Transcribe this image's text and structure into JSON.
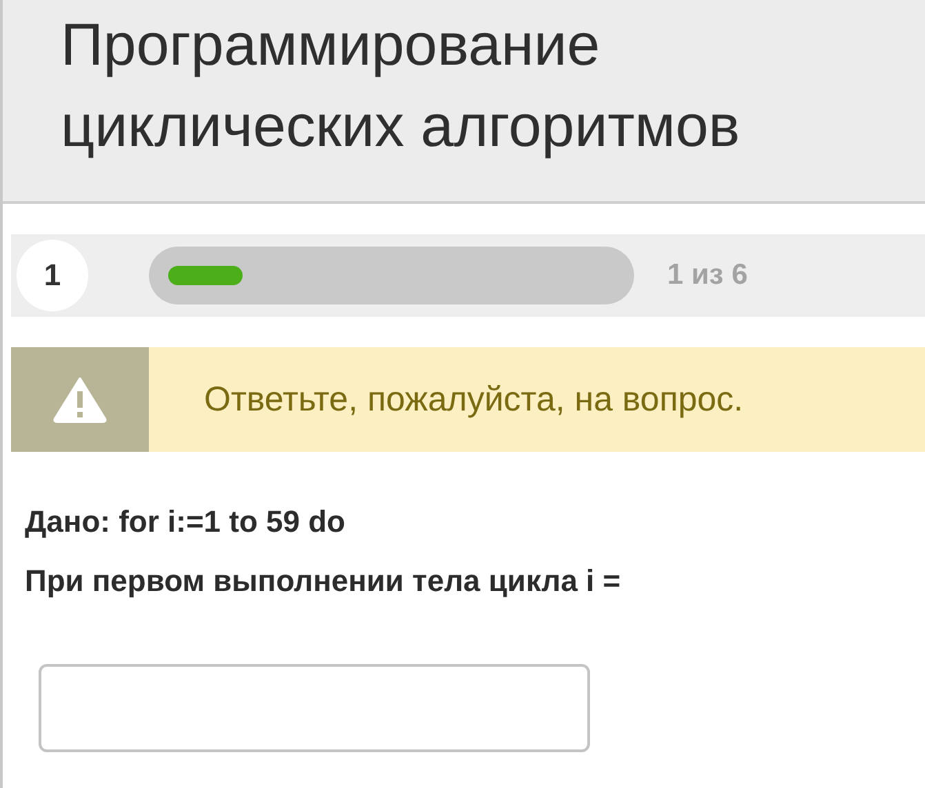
{
  "title": "Программирование циклических алгоритмов",
  "progress": {
    "question_number": "1",
    "level": 0.167,
    "counter": "1 из 6"
  },
  "alert": {
    "kind": "warning",
    "text": "Ответьте, пожалуйста, на вопрос."
  },
  "question": {
    "lines": [
      "Дано: for i:=1 to 59 do",
      "При первом выполнении тела цикла i ="
    ]
  }
}
